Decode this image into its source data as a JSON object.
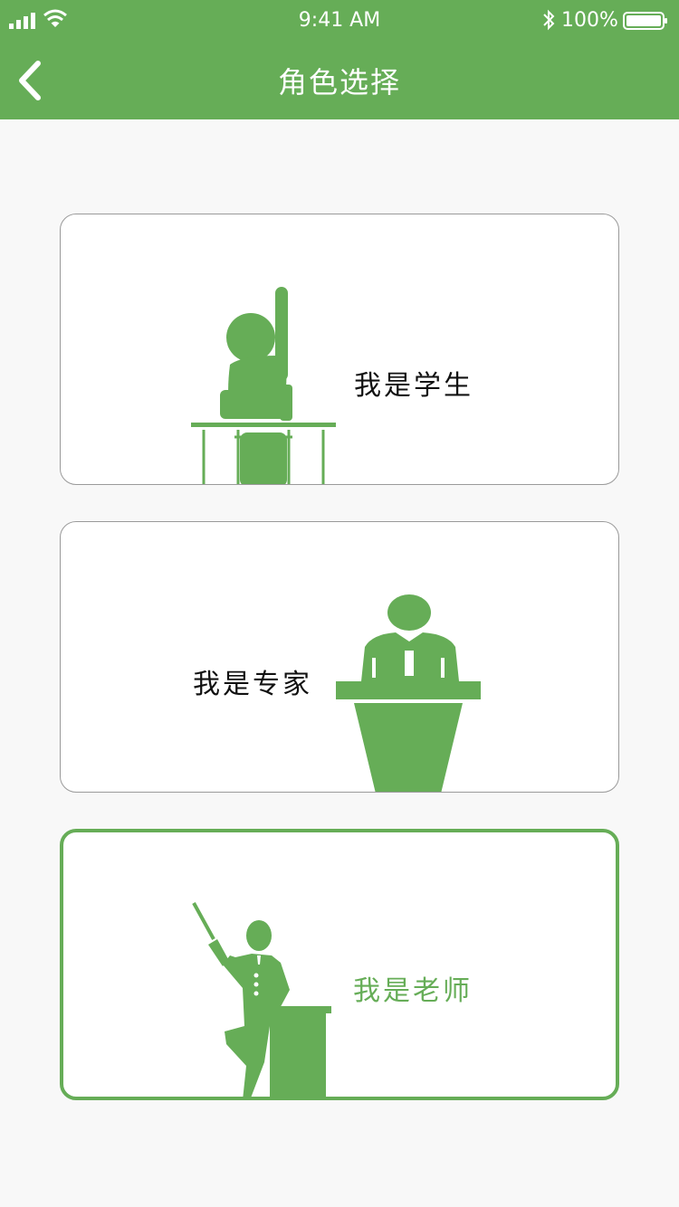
{
  "status_bar": {
    "time": "9:41 AM",
    "battery": "100%",
    "signal_icon": "signal-bars-icon",
    "wifi_icon": "wifi-icon",
    "bluetooth_icon": "bluetooth-icon",
    "battery_icon": "battery-full-icon"
  },
  "nav": {
    "title": "角色选择",
    "back_icon": "chevron-left-icon"
  },
  "roles": [
    {
      "label": "我是学生",
      "icon": "student-raising-hand-icon",
      "selected": false
    },
    {
      "label": "我是专家",
      "icon": "expert-at-podium-icon",
      "selected": false
    },
    {
      "label": "我是老师",
      "icon": "teacher-with-pointer-icon",
      "selected": true
    }
  ],
  "colors": {
    "accent": "#66ad57",
    "background": "#f8f8f8",
    "card_border": "#9a9a9a",
    "text": "#111111"
  }
}
